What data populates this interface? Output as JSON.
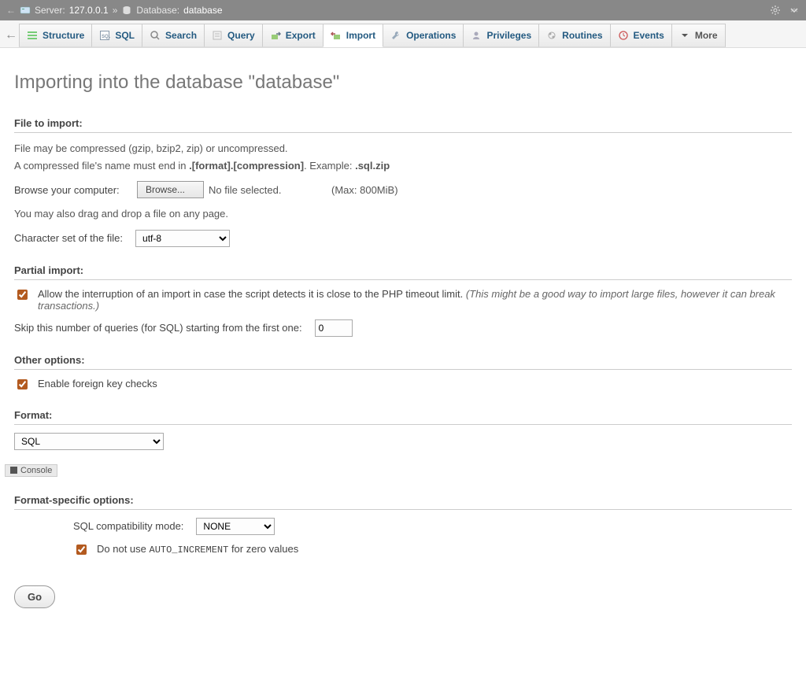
{
  "breadcrumb": {
    "server_label": "Server:",
    "server_value": "127.0.0.1",
    "db_label": "Database:",
    "db_value": "database"
  },
  "tabs": {
    "structure": "Structure",
    "sql": "SQL",
    "search": "Search",
    "query": "Query",
    "export": "Export",
    "import": "Import",
    "operations": "Operations",
    "privileges": "Privileges",
    "routines": "Routines",
    "events": "Events",
    "more": "More"
  },
  "page_title": "Importing into the database \"database\"",
  "file_section": {
    "heading": "File to import:",
    "line1": "File may be compressed (gzip, bzip2, zip) or uncompressed.",
    "line2a": "A compressed file's name must end in ",
    "line2b": ".[format].[compression]",
    "line2c": ". Example: ",
    "line2d": ".sql.zip",
    "browse_label": "Browse your computer:",
    "browse_button": "Browse...",
    "no_file": "No file selected.",
    "max": "(Max: 800MiB)",
    "dragdrop": "You may also drag and drop a file on any page.",
    "charset_label": "Character set of the file:",
    "charset_value": "utf-8"
  },
  "partial": {
    "heading": "Partial import:",
    "allow_label": "Allow the interruption of an import in case the script detects it is close to the PHP timeout limit.",
    "allow_hint": "(This might be a good way to import large files, however it can break transactions.)",
    "skip_label": "Skip this number of queries (for SQL) starting from the first one:",
    "skip_value": "0"
  },
  "other": {
    "heading": "Other options:",
    "fk_label": "Enable foreign key checks"
  },
  "format": {
    "heading": "Format:",
    "value": "SQL"
  },
  "console": {
    "label": "Console"
  },
  "format_specific": {
    "heading": "Format-specific options:",
    "compat_label": "SQL compatibility mode:",
    "compat_value": "NONE",
    "autoinc_a": "Do not use ",
    "autoinc_b": "AUTO_INCREMENT",
    "autoinc_c": " for zero values"
  },
  "go_button": "Go"
}
